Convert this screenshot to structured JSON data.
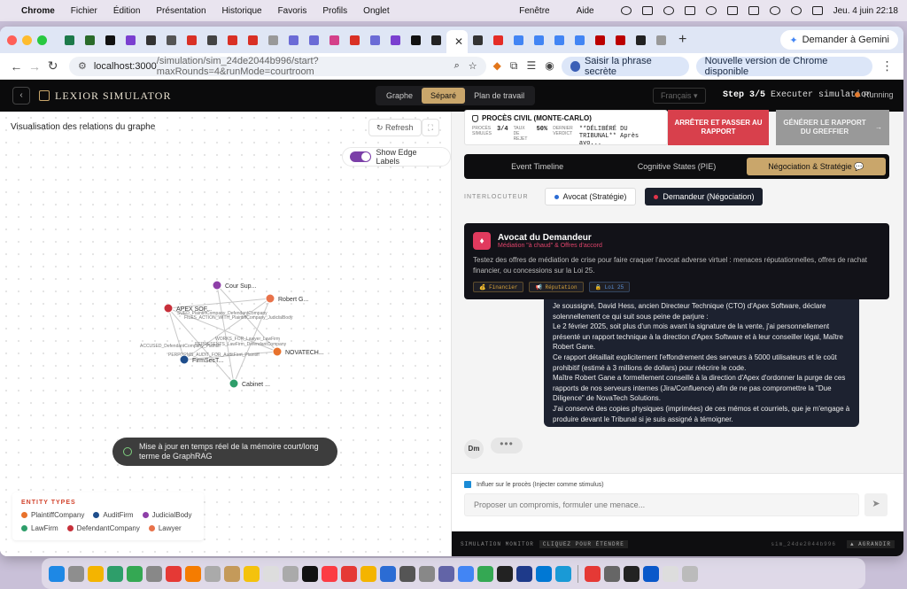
{
  "menubar": {
    "app": "Chrome",
    "items": [
      "Fichier",
      "Édition",
      "Présentation",
      "Historique",
      "Favoris",
      "Profils",
      "Onglet",
      "Fenêtre",
      "Aide"
    ],
    "clock": "Jeu. 4 juin 22:18"
  },
  "browser": {
    "gemini_button": "Demander à Gemini",
    "url_host": "localhost:3000",
    "url_path": "/simulation/sim_24de2044b996/start?maxRounds=4&runMode=courtroom",
    "secret_phrase": "Saisir la phrase secrète",
    "update_notice": "Nouvelle version de Chrome disponible",
    "tab_colors": [
      "#1d7a4a",
      "#2a6b2a",
      "#111",
      "#7a3fd0",
      "#333",
      "#555",
      "#d93025",
      "#444",
      "#d93025",
      "#d93025",
      "#999",
      "#6b6bd6",
      "#6b6bd6",
      "#d4408a",
      "#d93025",
      "#6b6bd6",
      "#7a3fd0",
      "#111",
      "#222"
    ],
    "right_tab_colors": [
      "#333",
      "#e52d27",
      "#4285f4",
      "#4285f4",
      "#4285f4",
      "#4285f4",
      "#b00",
      "#b00",
      "#222",
      "#999"
    ]
  },
  "app": {
    "brand": "LEXIOR SIMULATOR",
    "view_modes": [
      "Graphe",
      "Séparé",
      "Plan de travail"
    ],
    "active_view": "Séparé",
    "language": "Français ▾",
    "step": "Step 3/5",
    "step_label": "Executer simulation",
    "status": "Running"
  },
  "graph_panel": {
    "title": "Visualisation des relations du graphe",
    "refresh": "Refresh",
    "show_edge_labels": "Show Edge Labels",
    "toast": "Mise à jour en temps réel de la mémoire court/long terme de GraphRAG",
    "legend_title": "ENTITY TYPES",
    "legend": [
      {
        "label": "PlaintiffCompany",
        "color": "#e8722c"
      },
      {
        "label": "AuditFirm",
        "color": "#1f4e8c"
      },
      {
        "label": "JudicialBody",
        "color": "#8e3fa8"
      },
      {
        "label": "LawFirm",
        "color": "#2e9e6a"
      },
      {
        "label": "DefendantCompany",
        "color": "#c7303a"
      },
      {
        "label": "Lawyer",
        "color": "#e8724a"
      }
    ],
    "nodes": [
      {
        "label": "Cour Sup...",
        "color": "#8e3fa8"
      },
      {
        "label": "Robert G...",
        "color": "#e8724a"
      },
      {
        "label": "APEX SOF...",
        "color": "#c7303a"
      },
      {
        "label": "NOVATECH...",
        "color": "#e8722c"
      },
      {
        "label": "FirmSecT...",
        "color": "#1f4e8c"
      },
      {
        "label": "Cabinet ...",
        "color": "#2e9e6a"
      }
    ],
    "edge_labels": [
      "SUED_PlaintiffCompany_DefendantCompany",
      "FILES_ACTION_WITH_PlaintiffCompany_JudicialBody",
      "WORKS_FOR_Lawyer_LawFirm",
      "ACCUSED_DefendantCompany_Plaintiff",
      "PERFORMS_AUDIT_FOR_AuditFirm_Plaintiff",
      "REPRESENTS_LawFirm_DefendantCompany"
    ]
  },
  "case": {
    "title": "PROCÈS CIVIL (MONTE-CARLO)",
    "stats": [
      {
        "label": "PROCÈS SIMULÉS",
        "value": "3/4"
      },
      {
        "label": "TAUX DE REJET",
        "value": "50%"
      },
      {
        "label": "DERNIER VERDICT",
        "value": "**DÉLIBÉRÉ DU TRIBUNAL** Après avo..."
      }
    ],
    "stop_button": "ARRÊTER ET PASSER AU RAPPORT",
    "report_button": "GÉNÉRER LE RAPPORT DU GREFFIER"
  },
  "right_tabs": [
    "Event Timeline",
    "Cognitive States (PIE)",
    "Négociation & Stratégie 💬"
  ],
  "interlocutor": {
    "label": "INTERLOCUTEUR",
    "options": [
      {
        "label": "Avocat (Stratégie)",
        "color": "#2b6cd4"
      },
      {
        "label": "Demandeur (Négociation)",
        "color": "#e0344a"
      }
    ]
  },
  "strategy": {
    "title": "Avocat du Demandeur",
    "subtitle": "Médiation \"à chaud\" & Offres d'accord",
    "description": "Testez des offres de médiation de crise pour faire craquer l'avocat adverse virtuel : menaces réputationnelles, offres de rachat financier, ou concessions sur la Loi 25.",
    "tags": [
      {
        "label": "💰 Financier",
        "color": "#d7a23a"
      },
      {
        "label": "📢 Réputation",
        "color": "#d7a23a"
      },
      {
        "label": "🔒 Loi 25",
        "color": "#5a8fd6"
      }
    ]
  },
  "message": {
    "paragraphs": [
      "Je soussigné, David Hess, ancien Directeur Technique (CTO) d'Apex Software, déclare solennellement ce qui suit sous peine de parjure :",
      "Le 2 février 2025, soit plus d'un mois avant la signature de la vente, j'ai personnellement présenté un rapport technique à la direction d'Apex Software et à leur conseiller légal, Maître Robert Gane.",
      "Ce rapport détaillait explicitement l'effondrement des serveurs à 5000 utilisateurs et le coût prohibitif (estimé à 3 millions de dollars) pour réécrire le code.",
      "Maître Robert Gane a formellement conseillé à la direction d'Apex d'ordonner la purge de ces rapports de nos serveurs internes (Jira/Confluence) afin de ne pas compromettre la \"Due Diligence\" de NovaTech Solutions.",
      "J'ai conservé des copies physiques (imprimées) de ces mémos et courriels, que je m'engage à produire devant le Tribunal si je suis assigné à témoigner."
    ]
  },
  "chat": {
    "avatar": "Dm",
    "typing": "•••"
  },
  "composer": {
    "inject_label": "Influer sur le procès (Injecter comme stimulus)",
    "placeholder": "Proposer un compromis, formuler une menace..."
  },
  "monitor": {
    "label": "SIMULATION MONITOR",
    "expand": "CLIQUEZ POUR ÉTENDRE",
    "sim_id": "sim_24de2044b996",
    "grow": "▲ AGRANDIR"
  },
  "dock_colors": [
    "#1e88e5",
    "#8e8e8e",
    "#f4b400",
    "#2e9e6a",
    "#34a853",
    "#888",
    "#e53935",
    "#f57c00",
    "#aaa",
    "#c49a5a",
    "#f4c20d",
    "#ddd",
    "#aaa",
    "#111",
    "#fc3c44",
    "#e53935",
    "#f4b400",
    "#2b6cd4",
    "#555",
    "#888",
    "#6264a7",
    "#4285f4",
    "#34a853",
    "#222",
    "#1e3a8a",
    "#0078d4",
    "#1a9ad6",
    "#e53935",
    "#666",
    "#222",
    "#0a58ca",
    "#ddd",
    "#bbb"
  ]
}
